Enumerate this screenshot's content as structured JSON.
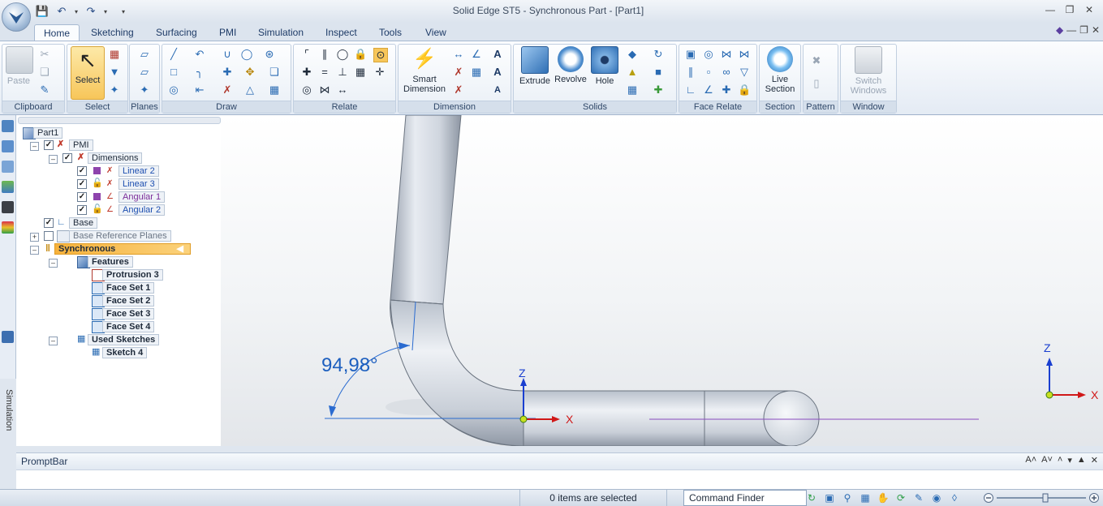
{
  "window": {
    "title": "Solid Edge ST5 - Synchronous Part - [Part1]"
  },
  "tabs": [
    {
      "label": "Home"
    },
    {
      "label": "Sketching"
    },
    {
      "label": "Surfacing"
    },
    {
      "label": "PMI"
    },
    {
      "label": "Simulation"
    },
    {
      "label": "Inspect"
    },
    {
      "label": "Tools"
    },
    {
      "label": "View"
    }
  ],
  "ribbon": {
    "groups": {
      "clipboard": "Clipboard",
      "select": "Select",
      "planes": "Planes",
      "draw": "Draw",
      "relate": "Relate",
      "dimension": "Dimension",
      "solids": "Solids",
      "face_relate": "Face Relate",
      "section": "Section",
      "pattern": "Pattern",
      "window": "Window"
    },
    "buttons": {
      "paste": "Paste",
      "select": "Select",
      "smart_dimension_1": "Smart",
      "smart_dimension_2": "Dimension",
      "extrude": "Extrude",
      "revolve": "Revolve",
      "hole": "Hole",
      "live_section_1": "Live",
      "live_section_2": "Section",
      "switch_windows_1": "Switch",
      "switch_windows_2": "Windows"
    }
  },
  "tree": {
    "part": "Part1",
    "pmi": "PMI",
    "dimensions": "Dimensions",
    "linear2": "Linear 2",
    "linear3": "Linear 3",
    "angular1": "Angular 1",
    "angular2": "Angular 2",
    "base": "Base",
    "base_ref": "Base Reference Planes",
    "synchronous": "Synchronous",
    "features": "Features",
    "protrusion3": "Protrusion 3",
    "faceset1": "Face Set 1",
    "faceset2": "Face Set 2",
    "faceset3": "Face Set 3",
    "faceset4": "Face Set 4",
    "used_sketches": "Used Sketches",
    "sketch4": "Sketch 4"
  },
  "left_toolbar": {
    "simulation": "Simulation"
  },
  "viewport": {
    "angle_label": "94,98°",
    "axis_z": "Z",
    "axis_x": "X",
    "triad_z": "Z",
    "triad_x": "X"
  },
  "promptbar": {
    "title": "PromptBar"
  },
  "status": {
    "selection": "0 items are selected",
    "command_finder": "Command Finder"
  },
  "colors": {
    "accent_tab": "#fafcfe",
    "highlight": "#f6b23c",
    "dimension_blue": "#1d5fbf"
  }
}
